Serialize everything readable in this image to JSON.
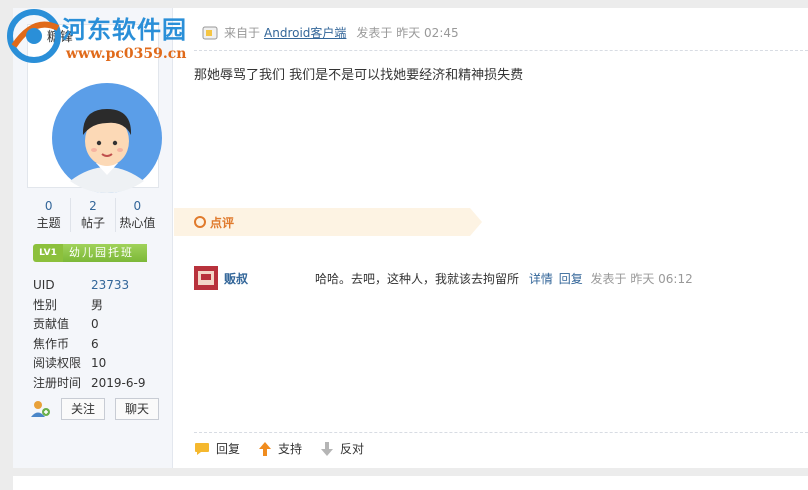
{
  "watermark": {
    "site_name": "河东软件园",
    "url": "www.pc0359.cn"
  },
  "user": {
    "name": "糖锋",
    "stats": [
      {
        "value": "0",
        "label": "主题"
      },
      {
        "value": "2",
        "label": "帖子"
      },
      {
        "value": "0",
        "label": "热心值"
      }
    ],
    "level": {
      "badge": "LV1",
      "name": "幼儿园托班"
    },
    "info": [
      {
        "key": "UID",
        "value": "23733"
      },
      {
        "key": "性别",
        "value": "男"
      },
      {
        "key": "贡献值",
        "value": "0"
      },
      {
        "key": "焦作币",
        "value": "6"
      },
      {
        "key": "阅读权限",
        "value": "10"
      },
      {
        "key": "注册时间",
        "value": "2019-6-9"
      }
    ],
    "follow_label": "关注",
    "chat_label": "聊天"
  },
  "post": {
    "from_prefix": "来自于",
    "source": "Android客户端",
    "posted": "发表于 昨天 02:45",
    "content": "那她辱骂了我们  我们是不是可以找她要经济和精神损失费"
  },
  "comment_section": {
    "title": "点评",
    "comments": [
      {
        "user": "贩叔",
        "text": "哈哈。去吧，这种人，我就该去拘留所",
        "detail_label": "详情",
        "reply_label": "回复",
        "time": "发表于 昨天 06:12"
      }
    ]
  },
  "post_actions": {
    "reply": "回复",
    "support": "支持",
    "oppose": "反对"
  },
  "colors": {
    "link": "#336699",
    "accent": "#e07a2c",
    "level_green": "#8cc03c"
  }
}
